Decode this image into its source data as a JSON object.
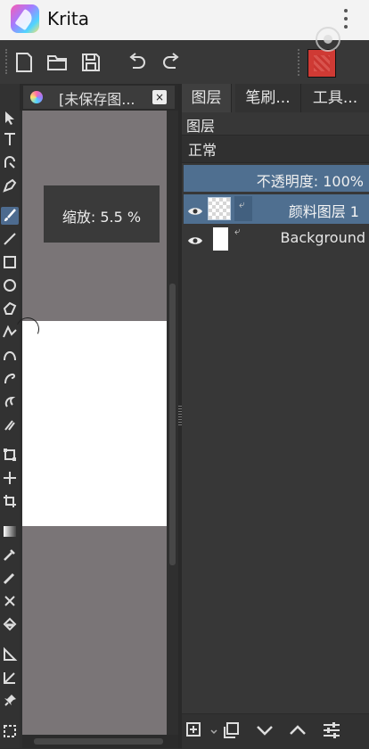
{
  "app": {
    "title": "Krita"
  },
  "toolbar": {
    "buttons": [
      "new-document",
      "open-document",
      "save-document",
      "undo",
      "redo"
    ],
    "foreground_color": "#cf3a34"
  },
  "toolbox": {
    "tools": [
      "select-shapes",
      "text",
      "edit-shapes",
      "calligraphy",
      "freehand-brush",
      "line",
      "rectangle",
      "ellipse",
      "polygon",
      "polyline",
      "bezier-curve",
      "freehand-path",
      "dynamic-brush",
      "multibrush",
      "transform",
      "move",
      "crop",
      "gradient",
      "color-picker",
      "smart-patch",
      "fill",
      "assistant",
      "measure",
      "reference-images",
      "rectangular-selection"
    ],
    "active": "freehand-brush"
  },
  "document": {
    "tab_label": "[未保存图...",
    "close_label": "×",
    "zoom_label": "缩放: 5.5 %"
  },
  "docker": {
    "tabs": [
      "图层",
      "笔刷...",
      "工具..."
    ],
    "active_tab": "图层",
    "title": "图层",
    "blend_mode": "正常",
    "opacity_label": "不透明度: 100%",
    "layers": [
      {
        "name": "颜料图层 1",
        "selected": true
      },
      {
        "name": "Background",
        "selected": false
      }
    ]
  },
  "colors": {
    "accent": "#4f6f90",
    "canvas_bg": "#7a7577",
    "panel_bg": "#373737"
  }
}
